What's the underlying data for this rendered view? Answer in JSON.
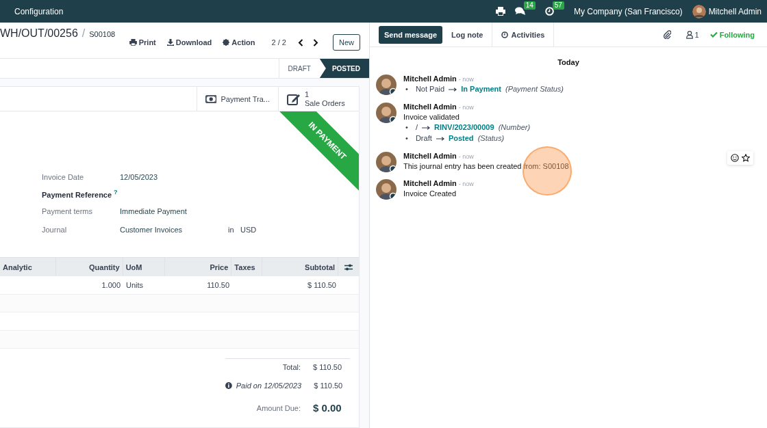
{
  "navbar": {
    "menu": [
      "Configuration"
    ],
    "messages_count": "14",
    "activities_count": "57",
    "company": "My Company (San Francisco)",
    "user": "Mitchell Admin"
  },
  "control_panel": {
    "breadcrumb": [
      "WH/OUT/00256",
      "S00108"
    ],
    "breadcrumb_separator": "/",
    "actions": [
      {
        "kind": "print",
        "label": "Print"
      },
      {
        "kind": "download",
        "label": "Download"
      },
      {
        "kind": "action",
        "label": "Action"
      }
    ],
    "pager": "2 / 2",
    "new_button": "New"
  },
  "statusbar": [
    {
      "label": "DRAFT",
      "selected": false
    },
    {
      "label": "POSTED",
      "selected": true
    }
  ],
  "smart_buttons": [
    {
      "kind": "payment",
      "label": "Payment Tra..."
    },
    {
      "kind": "sale",
      "count": "1",
      "label": "Sale Orders"
    }
  ],
  "ribbon": "IN PAYMENT",
  "fields": [
    {
      "label": "Invoice Date",
      "value": "12/05/2023",
      "emphasized": false
    },
    {
      "label": "Payment Reference",
      "help": "?",
      "emphasized": true
    },
    {
      "label": "Payment terms",
      "value": "Immediate Payment",
      "emphasized": false
    },
    {
      "label": "Journal",
      "value": "Customer Invoices",
      "joiner": "in",
      "currency": "USD",
      "emphasized": false
    }
  ],
  "table": {
    "columns": [
      "Analytic",
      "Quantity",
      "UoM",
      "Price",
      "Taxes",
      "Subtotal"
    ],
    "rows": [
      {
        "quantity": "1.000",
        "uom": "Units",
        "price": "110.50",
        "subtotal": "$ 110.50"
      }
    ]
  },
  "totals": {
    "total_label": "Total:",
    "total": "$ 110.50",
    "payment_label": "Paid on 12/05/2023",
    "payment": "$ 110.50",
    "due_label": "Amount Due:",
    "due": "$ 0.00"
  },
  "chatter": {
    "buttons": [
      {
        "label": "Send message",
        "selected": true
      },
      {
        "label": "Log note",
        "selected": false
      },
      {
        "label": "Activities",
        "selected": false
      }
    ],
    "followers": "1",
    "following": "Following",
    "date": "Today",
    "messages": [
      {
        "author": "Mitchell Admin",
        "time": "- now",
        "hovered": false,
        "changes": [
          {
            "bullet": "•",
            "old": "Not Paid",
            "new": "In Payment",
            "field": "(Payment Status)"
          }
        ]
      },
      {
        "author": "Mitchell Admin",
        "time": "- now",
        "body": "Invoice validated",
        "hovered": false,
        "changes": [
          {
            "bullet": "•",
            "old": "/",
            "new": "RINV/2023/00009",
            "field": "(Number)"
          },
          {
            "bullet": "•",
            "old": "Draft",
            "new": "Posted",
            "field": "(Status)"
          }
        ]
      },
      {
        "author": "Mitchell Admin",
        "time": "- now",
        "body": "This journal entry has been created from: S00108",
        "hovered": true
      },
      {
        "author": "Mitchell Admin",
        "time": "- now",
        "body": "Invoice Created",
        "hovered": false
      }
    ]
  }
}
